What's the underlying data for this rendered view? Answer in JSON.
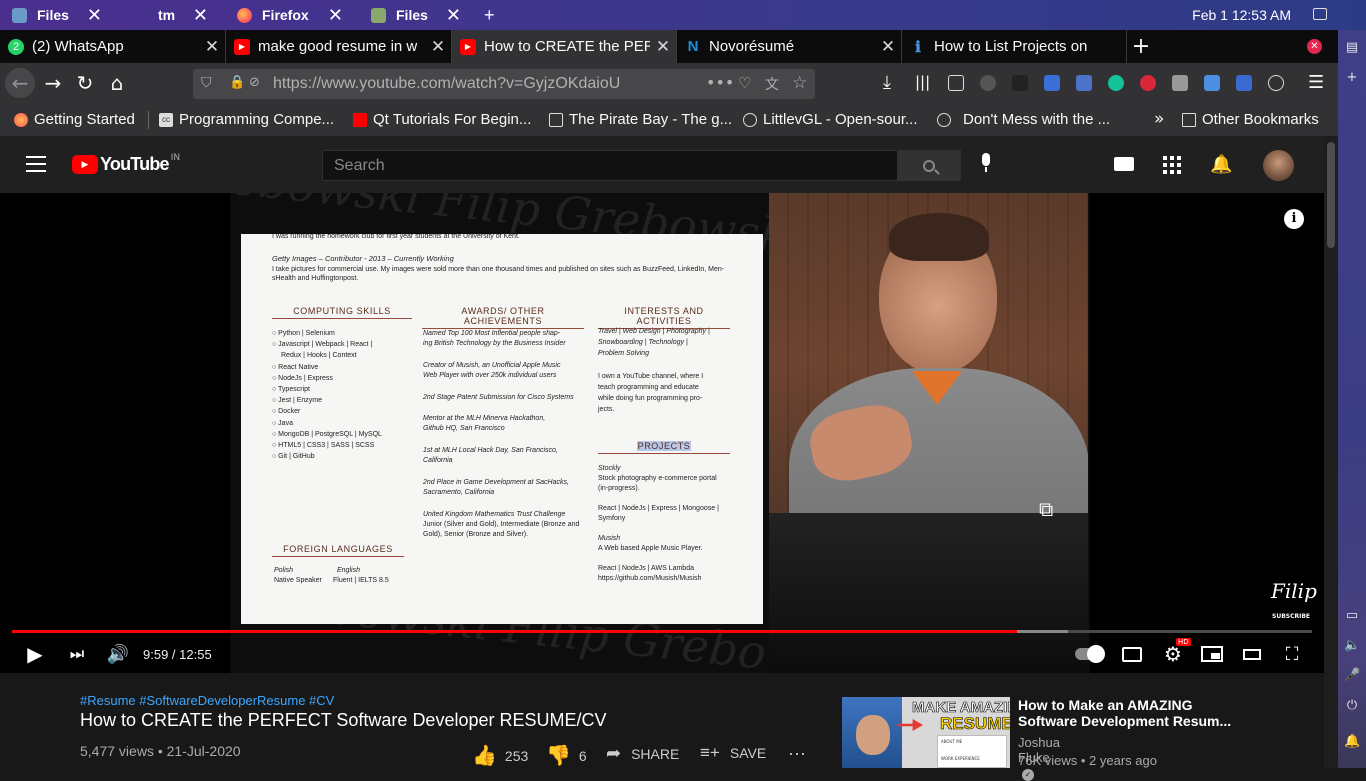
{
  "taskbar": {
    "tasks": [
      {
        "label": "Files",
        "icon": "files-icon"
      },
      {
        "label": "tm",
        "icon": ""
      },
      {
        "label": "Firefox",
        "icon": "firefox-icon"
      },
      {
        "label": "Files",
        "icon": "files-icon"
      }
    ],
    "clock": "Feb 1  12:53 AM"
  },
  "tabs": [
    {
      "title": "(2) WhatsApp",
      "icon": "whatsapp-icon"
    },
    {
      "title": "make good resume in w",
      "icon": "youtube-icon"
    },
    {
      "title": "How to CREATE the PERI",
      "icon": "youtube-icon",
      "active": true
    },
    {
      "title": "Novorésumé",
      "icon": "novoresume-icon"
    },
    {
      "title": "How to List Projects on",
      "icon": "info-icon"
    }
  ],
  "nav": {
    "url": "https://www.youtube.com/watch?v=GyjzOKdaioU"
  },
  "bookmarks": [
    {
      "label": "Getting Started",
      "icon": "firefox-icon"
    },
    {
      "label": "Programming Compe...",
      "icon": "cc-icon"
    },
    {
      "label": "Qt Tutorials For Begin...",
      "icon": "youtube-icon"
    },
    {
      "label": "The Pirate Bay - The g...",
      "icon": "piratebay-icon"
    },
    {
      "label": "LittlevGL - Open-sour...",
      "icon": "globe-icon"
    },
    {
      "label": "Don't Mess with the ...",
      "icon": "globe-icon"
    }
  ],
  "bookmarks_other": "Other Bookmarks",
  "youtube": {
    "logo": "YouTube",
    "region": "IN",
    "search_placeholder": "Search"
  },
  "resume": {
    "intro_line": "I was running the homework club for first year students at the University of Kent.",
    "job_title": "Getty Images – Contributor  -  2013 – Currently Working",
    "job_desc": "I take pictures for commercial use. My images were sold more than one thousand times and published on sites such as BuzzFeed, LinkedIn, Men-",
    "job_desc2": "sHealth and Huffingtonpost.",
    "skills_title": "COMPUTING SKILLS",
    "skills": [
      "Python | Selenium",
      "Javascript | Webpack | React |",
      "Redux | Hooks | Context",
      "React Native",
      "NodeJs | Express",
      "Typescript",
      "Jest | Enzyme",
      "Docker",
      "Java",
      "MongoDB | PostgreSQL | MySQL",
      "HTML5 | CSS3 | SASS | SCSS",
      "Git | GitHub"
    ],
    "awards_title": "AWARDS/ OTHER ACHIEVEMENTS",
    "awards": [
      "Named Top 100 Most Inflential people shap-",
      "ing British Technology by the Business Insider",
      "Creator of Musish, an Unofficial Apple Music",
      "Web Player with over 250k individual users",
      "2nd Stage Patent Submission for Cisco Systems",
      "Mentor at the MLH Minerva Hackathon,",
      "Github HQ, San Francisco",
      "1st at MLH Local Hack Day, San Francisco,",
      "California",
      "2nd Place in Game Development at SacHacks,",
      "Sacramento, California",
      "United Kingdom Mathematics Trust Challenge",
      "Junior (Silver and Gold), Intermediate (Bronze and",
      "Gold), Senior (Bronze and Silver)."
    ],
    "interests_title": "INTERESTS AND ACTIVITIES",
    "interests": [
      "Travel | Web Design | Photography |",
      "Snowboarding | Technology |",
      "Problem Solving",
      "I own a YouTube channel, where I",
      "teach programming and educate",
      "while doing fun programming pro-",
      "jects."
    ],
    "projects_title": "PROJECTS",
    "projects": [
      "Stockly",
      "Stock photography e-commerce portal",
      "(in-progress).",
      "React | NodeJs | Express | Mongoose |",
      "Symfony",
      "Musish",
      "A Web based Apple Music Player.",
      "React | NodeJs | AWS Lambda",
      "https://github.com/Musish/Musish"
    ],
    "lang_title": "FOREIGN LANGUAGES",
    "lang1": "Polish",
    "lang1_level": "Native Speaker",
    "lang2": "English",
    "lang2_level": "Fluent | IELTS 8.5"
  },
  "watermark": {
    "name": "Filip",
    "sub": "SUBSCRIBE"
  },
  "bg_text": [
    "ebowski  Filip Grebowski  Filip",
    "Grebowski  Filip Grebowski  Filip G"
  ],
  "player": {
    "time": "9:59 / 12:55",
    "progress_fraction": 0.773,
    "buffered_fraction": 0.812
  },
  "video": {
    "tags": "#Resume #SoftwareDeveloperResume #CV",
    "title": "How to CREATE the PERFECT Software Developer RESUME/CV",
    "meta": "5,477 views • 21-Jul-2020",
    "likes": "253",
    "dislikes": "6",
    "share": "SHARE",
    "save": "SAVE"
  },
  "recommendation": {
    "title": "How to Make an AMAZING Software Development Resum...",
    "channel": "Joshua Fluke",
    "meta": "76K views • 2 years ago",
    "thumb_text1": "MAKE AMAZING",
    "thumb_text2": "RESUMES",
    "thumb_small1": "ABOUT ME",
    "thumb_small2": "WORK EXPERIENCE"
  }
}
